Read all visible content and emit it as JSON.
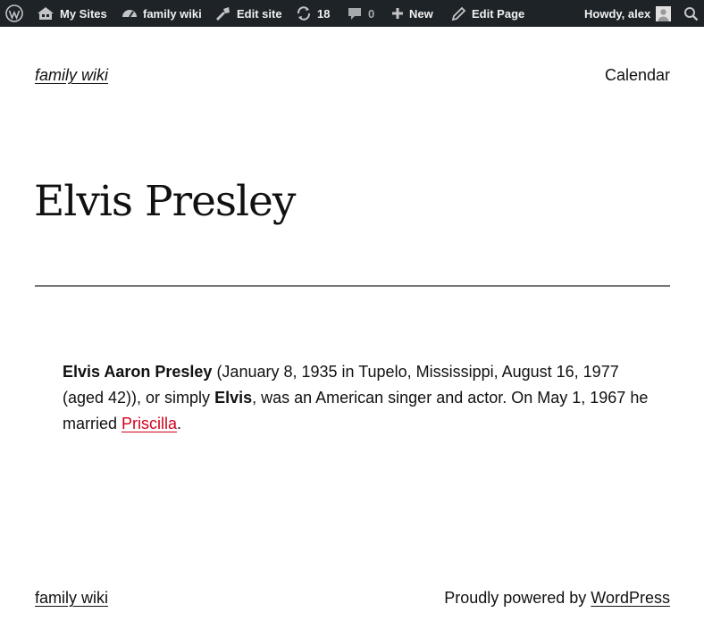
{
  "admin_bar": {
    "wordpress_icon": "wordpress-logo-icon",
    "my_sites": "My Sites",
    "site_name": "family wiki",
    "edit_site": "Edit site",
    "updates_count": "18",
    "comments_count": "0",
    "new": "New",
    "edit_page": "Edit Page",
    "howdy": "Howdy, alex"
  },
  "header": {
    "site_title": "family wiki",
    "nav": [
      "Calendar"
    ]
  },
  "page": {
    "title": "Elvis Presley",
    "content": {
      "bold_name": "Elvis Aaron Presley",
      "text1": " (January 8, 1935 in Tupelo, Mississippi, August 16, 1977 (aged 42)), or simply ",
      "bold_short": "Elvis",
      "text2": ", was an American singer and actor. On May 1, 1967 he married ",
      "link": "Priscilla",
      "text3": "."
    }
  },
  "footer": {
    "site_title": "family wiki",
    "credit_prefix": "Proudly powered by ",
    "credit_link": "WordPress"
  },
  "colors": {
    "admin_bar_bg": "#1d2327",
    "link_red": "#d0021b",
    "separator": "#777777"
  }
}
